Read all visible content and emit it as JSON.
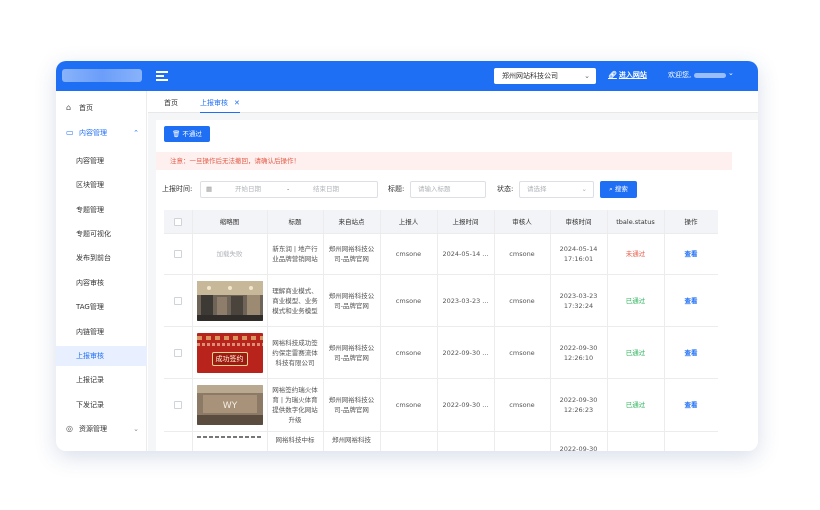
{
  "header": {
    "site_select": "郑州网站科技公司",
    "enter_site": "进入网站",
    "welcome": "欢迎您,"
  },
  "sidebar": {
    "items": [
      {
        "label": "首页",
        "icon": "home-icon"
      },
      {
        "label": "内容管理",
        "icon": "folder-icon",
        "open": true
      },
      {
        "label": "资源管理",
        "icon": "resource-icon"
      }
    ],
    "sub_items": [
      "内容管理",
      "区块管理",
      "专题管理",
      "专题可视化",
      "发布到前台",
      "内容审核",
      "TAG管理",
      "内链管理",
      "上报审核",
      "上报记录",
      "下发记录"
    ],
    "active_sub": "上报审核"
  },
  "tabs": [
    {
      "label": "首页"
    },
    {
      "label": "上报审核",
      "active": true,
      "close": "✕"
    }
  ],
  "toolbar": {
    "reject_button": "不通过"
  },
  "notice": "注意：一旦操作后无法撤回，请确认后操作！",
  "filters": {
    "report_time_label": "上报时间:",
    "start_placeholder": "开始日期",
    "range_sep": "-",
    "end_placeholder": "结束日期",
    "title_label": "标题:",
    "title_placeholder": "请输入标题",
    "status_label": "状态:",
    "status_placeholder": "请选择",
    "search_button": "搜索"
  },
  "table": {
    "columns": [
      "",
      "缩略图",
      "标题",
      "来自站点",
      "上报人",
      "上报时间",
      "审核人",
      "审核时间",
      "tbale.status",
      "操作"
    ],
    "rows": [
      {
        "thumb": "加载失败",
        "thumb_type": "failed",
        "title": "新东润 | 地产行业品牌营销网站",
        "site": "郑州网裕科技公司-品牌官网",
        "reporter": "cmsone",
        "report_time": "2024-05-14 ...",
        "auditor": "cmsone",
        "audit_time": "2024-05-14 17:16:01",
        "status": "未通过",
        "status_kind": "no",
        "op": "查看"
      },
      {
        "thumb": "",
        "thumb_type": "mall",
        "title": "理解商业模式、商业模型、业务模式和业务模型",
        "site": "郑州网裕科技公司-品牌官网",
        "reporter": "cmsone",
        "report_time": "2023-03-23 ...",
        "auditor": "cmsone",
        "audit_time": "2023-03-23 17:32:24",
        "status": "已通过",
        "status_kind": "ok",
        "op": "查看"
      },
      {
        "thumb": "成功签约",
        "thumb_type": "signed",
        "title": "网裕科技成功签约保定雷赛流体科技有限公司",
        "site": "郑州网裕科技公司-品牌官网",
        "reporter": "cmsone",
        "report_time": "2022-09-30 ...",
        "auditor": "cmsone",
        "audit_time": "2022-09-30 12:26:10",
        "status": "已通过",
        "status_kind": "ok",
        "op": "查看"
      },
      {
        "thumb": "",
        "thumb_type": "wall",
        "title": "网裕签约瑞火体育 | 为瑞火体育提供数字化网站升级",
        "site": "郑州网裕科技公司-品牌官网",
        "reporter": "cmsone",
        "report_time": "2022-09-30 ...",
        "auditor": "cmsone",
        "audit_time": "2022-09-30 12:26:23",
        "status": "已通过",
        "status_kind": "ok",
        "op": "查看"
      },
      {
        "thumb": "",
        "thumb_type": "partial",
        "title": "网裕科技中标",
        "site": "郑州网裕科技",
        "reporter": "",
        "report_time": "",
        "auditor": "",
        "audit_time": "2022-09-30",
        "status": "",
        "status_kind": "",
        "op": ""
      }
    ]
  }
}
